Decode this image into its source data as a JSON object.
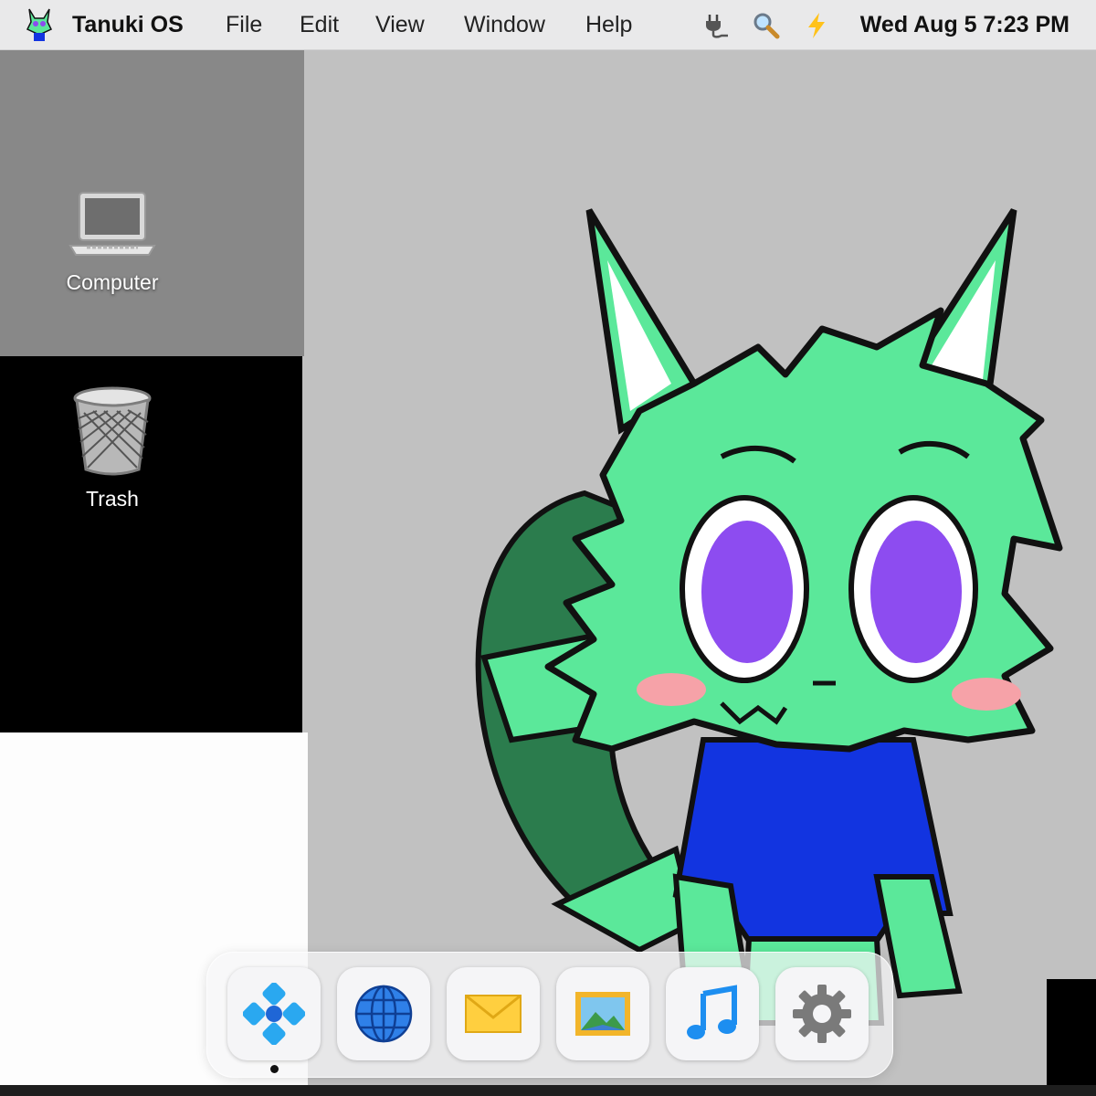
{
  "menubar": {
    "logo_icon": "tanuki-mascot-logo",
    "app_name": "Tanuki OS",
    "menus": [
      "File",
      "Edit",
      "View",
      "Window",
      "Help"
    ],
    "status_icons": [
      "power-plug-icon",
      "search-icon",
      "lightning-icon"
    ],
    "clock": "Wed Aug 5 7:23 PM"
  },
  "desktop": {
    "icons": [
      {
        "label": "Computer",
        "icon": "laptop-icon"
      },
      {
        "label": "Trash",
        "icon": "trash-icon"
      }
    ]
  },
  "dock": {
    "items": [
      {
        "icon": "launcher-icon",
        "running": true
      },
      {
        "icon": "globe-icon",
        "running": false
      },
      {
        "icon": "mail-icon",
        "running": false
      },
      {
        "icon": "photos-icon",
        "running": false
      },
      {
        "icon": "music-icon",
        "running": false
      },
      {
        "icon": "gear-icon",
        "running": false
      }
    ]
  },
  "colors": {
    "mascot_green": "#5be89a",
    "mascot_dark_green": "#2b7c4d",
    "mascot_shirt": "#1234e0",
    "mascot_eyes": "#8d4cf0"
  }
}
